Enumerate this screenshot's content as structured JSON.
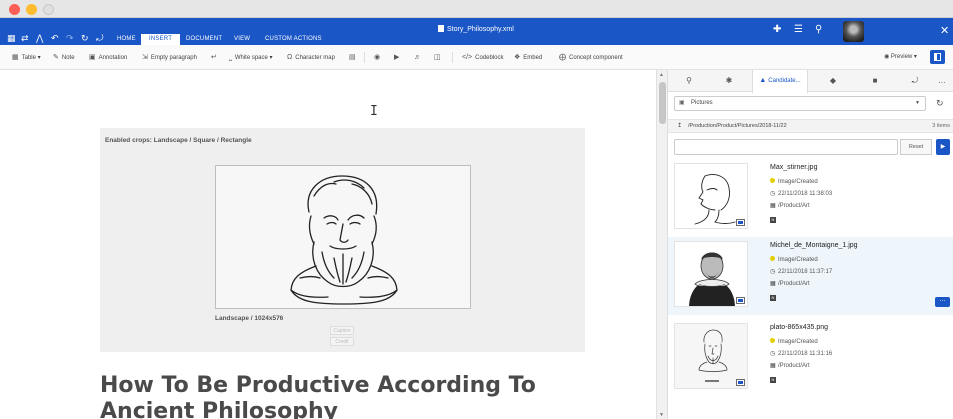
{
  "window": {
    "document_title": "Story_Philosophy.xml"
  },
  "menu": {
    "tabs": [
      {
        "label": "HOME",
        "active": false
      },
      {
        "label": "INSERT",
        "active": true
      },
      {
        "label": "DOCUMENT",
        "active": false
      },
      {
        "label": "VIEW",
        "active": false
      },
      {
        "label": "CUSTOM ACTIONS",
        "active": false
      }
    ]
  },
  "toolbar": {
    "table": "Table",
    "note": "Note",
    "annotation": "Annotation",
    "empty_paragraph": "Empty paragraph",
    "white_space": "White space",
    "character_map": "Character map",
    "codeblock": "Codeblock",
    "embed": "Embed",
    "concept_component": "Concept component",
    "preview": "Preview"
  },
  "editor": {
    "enabled_crops": "Enabled crops: Landscape / Square / Rectangle",
    "figure_label": "Landscape / 1024x576",
    "caption_placeholder": "Caption",
    "credit_placeholder": "Credit",
    "heading": "How To Be Productive According To Ancient Philosophy"
  },
  "panel": {
    "active_tab": "Candidate...",
    "source_select": "Pictures",
    "path": "/Production/Product/Pictures/2018-11/22",
    "item_count": "3 items",
    "search_value": "",
    "reset_label": "Reset",
    "items": [
      {
        "name": "Max_stirner.jpg",
        "status": "Image/Created",
        "date": "22/11/2018 11:38:03",
        "folder": "/Product/Art",
        "badge": "N"
      },
      {
        "name": "Michel_de_Montaigne_1.jpg",
        "status": "Image/Created",
        "date": "22/11/2018 11:37:17",
        "folder": "/Product/Art",
        "badge": "N"
      },
      {
        "name": "plato-865x435.png",
        "status": "Image/Created",
        "date": "22/11/2018 11:31:16",
        "folder": "/Product/Art",
        "badge": "N"
      }
    ]
  },
  "colors": {
    "accent": "#1a56c6",
    "status_dot": "#e2cf00",
    "heading": "#4a4a4a"
  }
}
